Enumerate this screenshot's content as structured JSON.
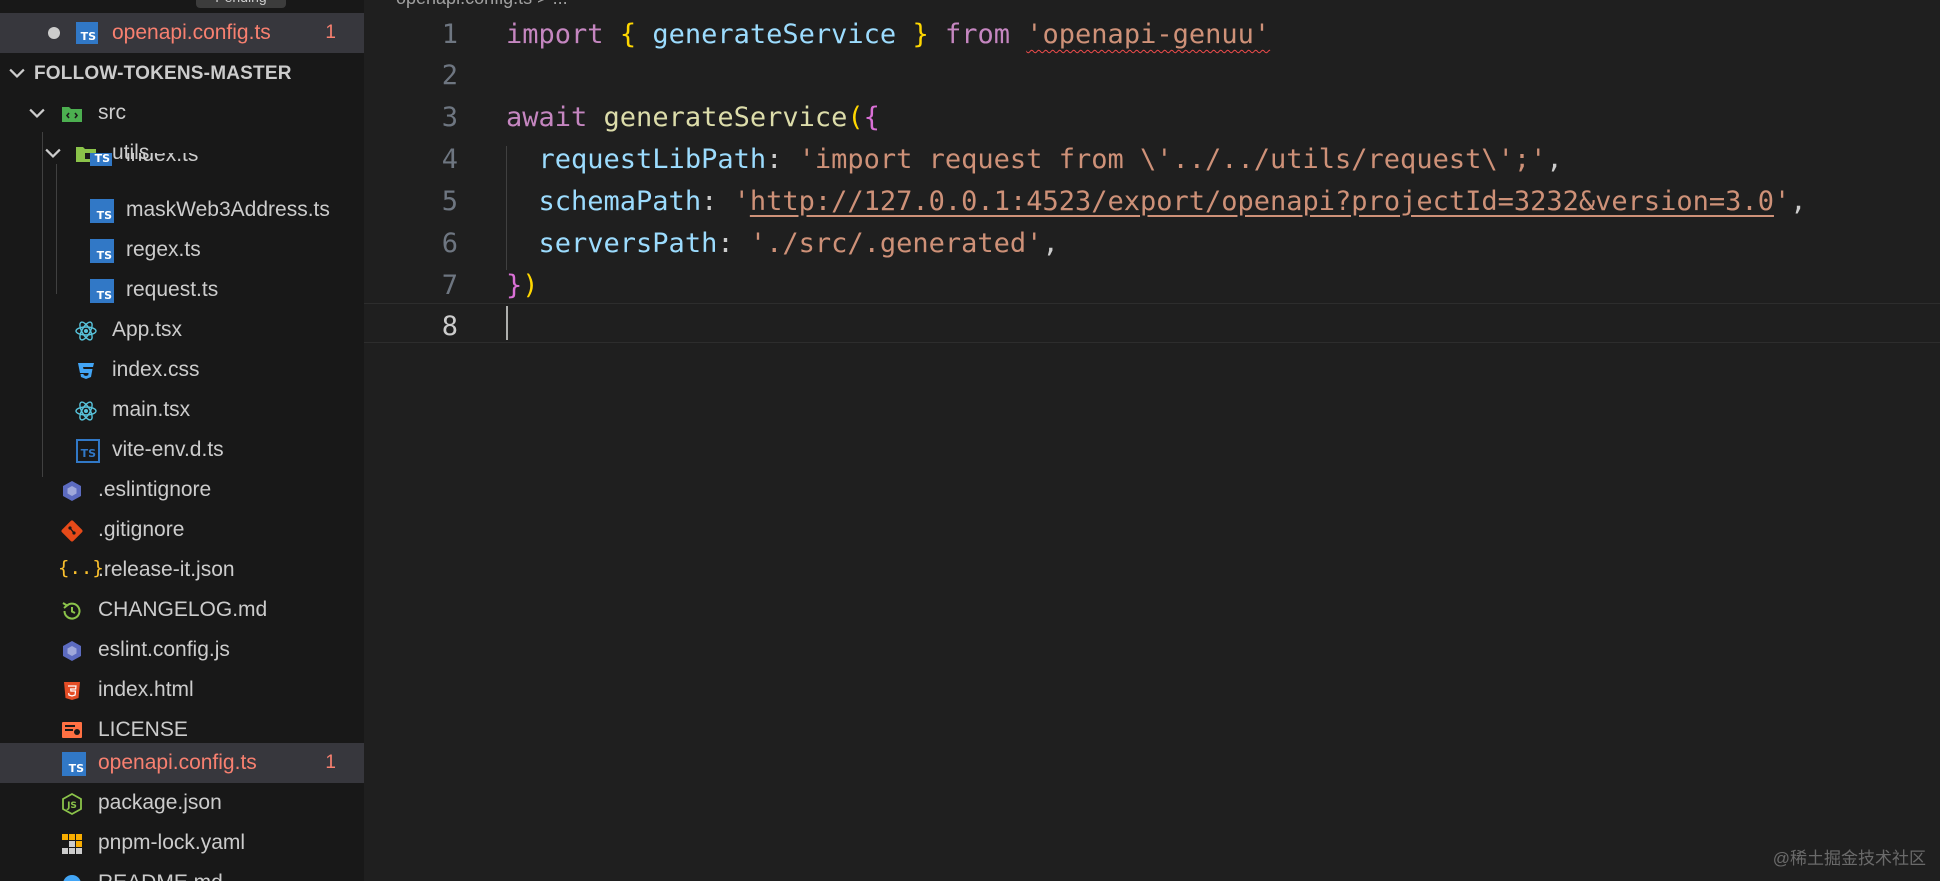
{
  "top_tab_pill": "Pending",
  "open_editor": {
    "file_name": "openapi.config.ts",
    "problem_count": "1"
  },
  "explorer": {
    "section_title": "FOLLOW-TOKENS-MASTER",
    "items": [
      {
        "label": "src",
        "icon": "folder-src-icon"
      },
      {
        "label": "utils",
        "icon": "folder-utils-icon"
      },
      {
        "label": "index.ts",
        "icon": "ts-file-icon"
      },
      {
        "label": "maskWeb3Address.ts",
        "icon": "ts-file-icon"
      },
      {
        "label": "regex.ts",
        "icon": "ts-file-icon"
      },
      {
        "label": "request.ts",
        "icon": "ts-file-icon"
      },
      {
        "label": "App.tsx",
        "icon": "react-icon"
      },
      {
        "label": "index.css",
        "icon": "css-icon"
      },
      {
        "label": "main.tsx",
        "icon": "react-icon"
      },
      {
        "label": "vite-env.d.ts",
        "icon": "ts-def-icon"
      },
      {
        "label": ".eslintignore",
        "icon": "eslint-icon"
      },
      {
        "label": ".gitignore",
        "icon": "git-icon"
      },
      {
        "label": ".release-it.json",
        "icon": "json-icon"
      },
      {
        "label": "CHANGELOG.md",
        "icon": "changelog-icon"
      },
      {
        "label": "eslint.config.js",
        "icon": "eslint-icon"
      },
      {
        "label": "index.html",
        "icon": "html-icon"
      },
      {
        "label": "LICENSE",
        "icon": "license-icon"
      },
      {
        "label": "openapi.config.ts",
        "icon": "ts-file-icon",
        "badge": "1"
      },
      {
        "label": "package.json",
        "icon": "node-js-icon"
      },
      {
        "label": "pnpm-lock.yaml",
        "icon": "pnpm-icon"
      },
      {
        "label": "README.md",
        "icon": "readme-icon"
      }
    ]
  },
  "editor": {
    "breadcrumb": "openapi.config.ts > ...",
    "line_numbers": [
      "1",
      "2",
      "3",
      "4",
      "5",
      "6",
      "7",
      "8"
    ],
    "current_line": "8",
    "lines": {
      "l1": {
        "import_kw": "import",
        "open_brace": "{",
        "name": "generateService",
        "close_brace": "}",
        "from_kw": "from",
        "module": "'openapi-genuu'"
      },
      "l3": {
        "await_kw": "await",
        "fn": "generateService",
        "open_paren": "(",
        "open_brace": "{"
      },
      "l4": {
        "key": "requestLibPath",
        "colon": ": ",
        "value": "'import request from \\'../../utils/request\\';'",
        "comma": ","
      },
      "l5": {
        "key": "schemaPath",
        "colon": ": ",
        "quote_open": "'",
        "url": "http://127.0.0.1:4523/export/openapi?projectId=3232&version=3.0",
        "quote_close": "'",
        "comma": ","
      },
      "l6": {
        "key": "serversPath",
        "colon": ": ",
        "value": "'./src/.generated'",
        "comma": ","
      },
      "l7": {
        "close_brace": "}",
        "close_paren": ")"
      }
    }
  },
  "watermark": "@稀土掘金技术社区",
  "colors": {
    "keyword": "#c586c0",
    "function": "#dcdcaa",
    "variable": "#9cdcfe",
    "string": "#ce9178",
    "error": "#f88070",
    "ts_blue": "#3178c6"
  }
}
